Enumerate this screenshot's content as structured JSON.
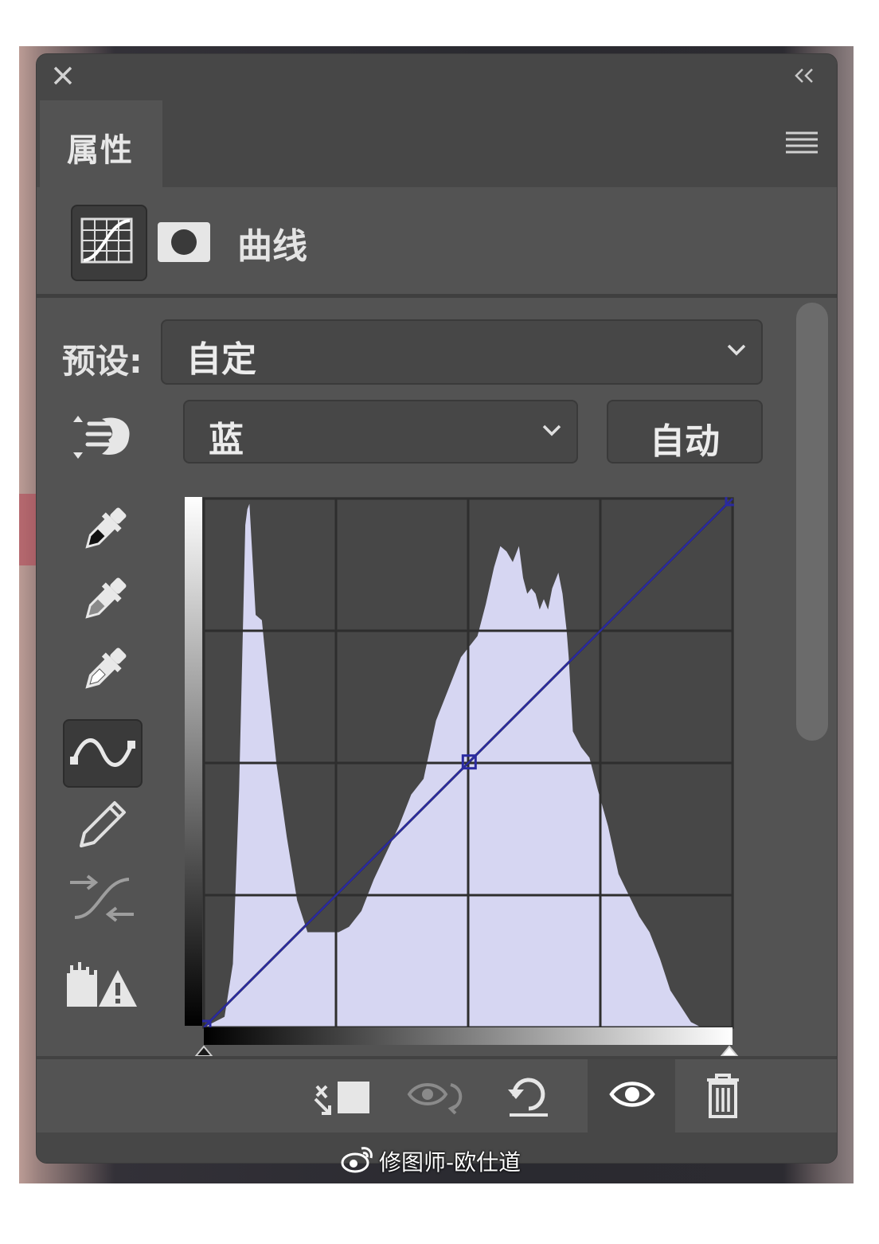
{
  "panel": {
    "tab_label": "属性",
    "adjustment_title": "曲线",
    "preset_label": "预设:",
    "preset_value": "自定",
    "channel_value": "蓝",
    "auto_label": "自动"
  },
  "icons": {
    "close": "close-icon",
    "collapse": "double-chevron-left-icon",
    "menu": "hamburger-menu-icon",
    "curves_adjustment": "curves-adjustment-icon",
    "layer_mask": "layer-mask-icon",
    "on_image_adjust": "targeted-adjustment-hand-icon",
    "black_point": "black-eyedropper-icon",
    "gray_point": "gray-eyedropper-icon",
    "white_point": "white-eyedropper-icon",
    "curve_tool": "edit-points-curve-icon",
    "pencil_tool": "pencil-draw-icon",
    "smooth": "smooth-curve-icon",
    "clipping": "clipping-warning-icon",
    "clip_to_layer": "clip-to-layer-icon",
    "view_previous": "view-previous-state-icon",
    "reset": "reset-icon",
    "visibility": "eye-visibility-icon",
    "delete": "trash-icon"
  },
  "curve": {
    "channel_color": "#2a2aa0",
    "histogram_color": "#d6d6f2",
    "control_points": [
      {
        "input": 0,
        "output": 0
      },
      {
        "input": 128,
        "output": 128
      },
      {
        "input": 255,
        "output": 255
      }
    ]
  },
  "watermark": {
    "text": "修图师-欧仕道",
    "icon": "weibo-logo-icon"
  }
}
